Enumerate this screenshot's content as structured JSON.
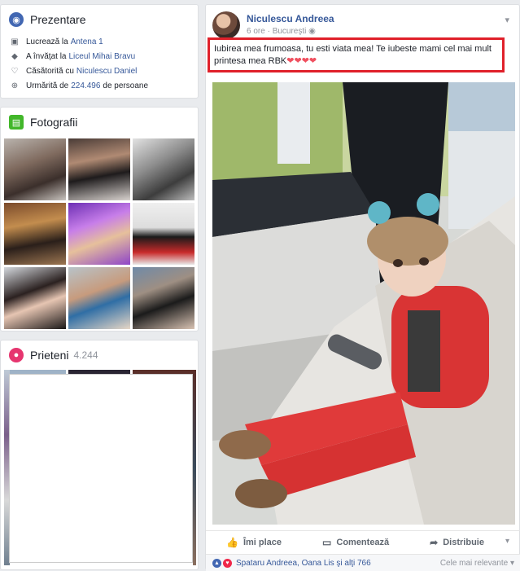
{
  "intro": {
    "title": "Prezentare",
    "rows": [
      {
        "prefix": "Lucrează la",
        "link": "Antena 1",
        "icon": "briefcase-icon"
      },
      {
        "prefix": "A învăţat la",
        "link": "Liceul Mihai Bravu",
        "icon": "graduation-cap-icon"
      },
      {
        "prefix": "Căsătorită cu",
        "link": "Niculescu Daniel",
        "icon": "heart-icon"
      },
      {
        "prefix": "Urmărită de",
        "link": "224.496",
        "suffix": "de persoane",
        "icon": "follow-icon"
      }
    ]
  },
  "photos": {
    "title": "Fotografii"
  },
  "friends": {
    "title": "Prieteni",
    "count": "4.244"
  },
  "post": {
    "author": "Niculescu Andreea",
    "time": "6 ore",
    "location": "Bucureşti",
    "text_line1": "Iubirea mea frumoasa, tu esti viata mea! Te iubeste mami cel mai mult",
    "text_line2": "printesa mea RBK",
    "hearts": "❤❤❤❤",
    "actions": {
      "like": "Îmi place",
      "comment": "Comentează",
      "share": "Distribuie"
    },
    "reactions": {
      "who": "Spataru Andreea, Oana Lis şi alţi 766",
      "sort": "Cele mai relevante"
    }
  },
  "colors": {
    "link": "#365899",
    "highlight": "#e0202a",
    "hearts": "#f0505f"
  }
}
